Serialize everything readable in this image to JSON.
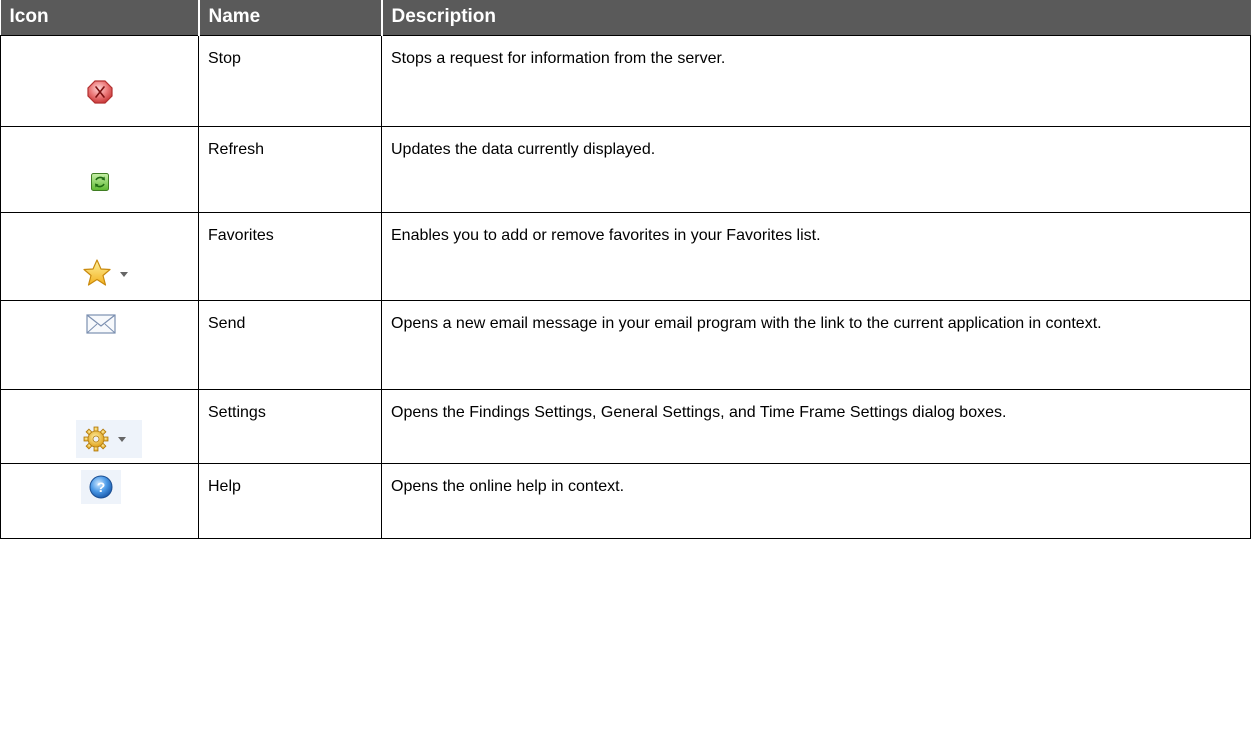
{
  "table": {
    "headers": [
      "Icon",
      "Name",
      "Description"
    ],
    "rows": [
      {
        "icon": "stop-icon",
        "name": "Stop",
        "description": "Stops a request for information from the server."
      },
      {
        "icon": "refresh-icon",
        "name": "Refresh",
        "description": "Updates the data currently displayed."
      },
      {
        "icon": "favorites-star-icon",
        "name": "Favorites",
        "description": "Enables you to add or remove favorites in your Favorites list."
      },
      {
        "icon": "send-envelope-icon",
        "name": "Send",
        "description": "Opens a new email message in your email program with the link to the current application in context."
      },
      {
        "icon": "settings-gear-icon",
        "name": "Settings",
        "description": "Opens the Findings Settings, General Settings, and Time Frame Settings dialog boxes."
      },
      {
        "icon": "help-icon",
        "name": "Help",
        "description": "Opens the online help in context."
      }
    ]
  },
  "colors": {
    "header_bg": "#5a5a5a",
    "header_text": "#ffffff",
    "border": "#000000"
  }
}
